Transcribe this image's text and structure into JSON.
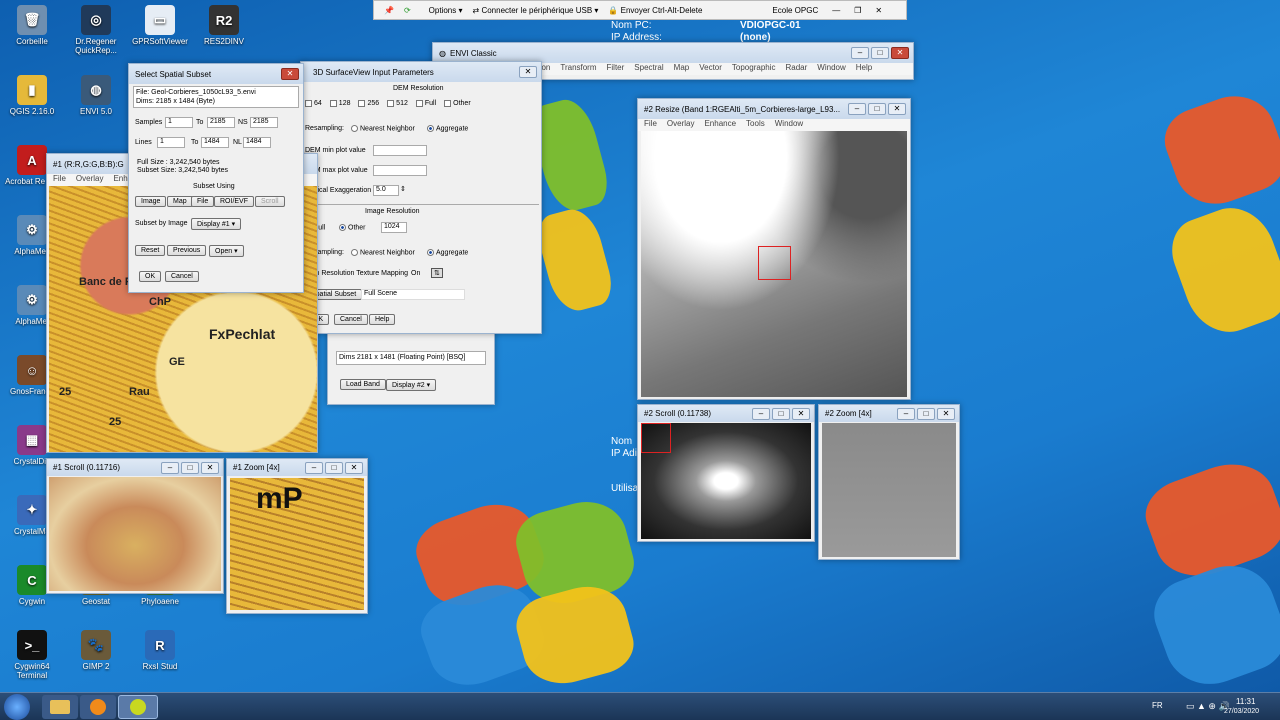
{
  "desktop": {
    "icons": [
      {
        "label": "Corbeille",
        "glyph": "🗑",
        "color": "#6f8fb0"
      },
      {
        "label": "Dr.Regener QuickRep...",
        "glyph": "◎",
        "color": "#203a5a"
      },
      {
        "label": "GPRSoftViewer",
        "glyph": "▭",
        "color": "#e6edf5"
      },
      {
        "label": "RES2DINV",
        "glyph": "R2",
        "color": "#333"
      },
      {
        "label": "QGIS 2.16.0",
        "glyph": "▮",
        "color": "#e5b93a"
      },
      {
        "label": "ENVI 5.0",
        "glyph": "◍",
        "color": "#3a5a7a"
      },
      {
        "label": "Acrobat Re DC",
        "glyph": "A",
        "color": "#c21d1d"
      },
      {
        "label": "AlphaMeli",
        "glyph": "⚙",
        "color": "#5a8ab8"
      },
      {
        "label": "AlphaMel",
        "glyph": "⚙",
        "color": "#5a8ab8"
      },
      {
        "label": "GnosFrance",
        "glyph": "☺",
        "color": "#7a4a2a"
      },
      {
        "label": "CrystalDiff",
        "glyph": "▦",
        "color": "#8a3a8a"
      },
      {
        "label": "CrystalMa",
        "glyph": "✦",
        "color": "#3a6aba"
      },
      {
        "label": "Cygwin",
        "glyph": "C",
        "color": "#1a8a2a"
      },
      {
        "label": "Geostat",
        "glyph": "G",
        "color": "#6a6a2a"
      },
      {
        "label": "Phyloaene",
        "glyph": "P",
        "color": "#3a7a3a"
      },
      {
        "label": "Cygwin64 Terminal",
        "glyph": ">_",
        "color": "#111"
      },
      {
        "label": "GIMP 2",
        "glyph": "🐾",
        "color": "#6a5a3a"
      },
      {
        "label": "RxsI Stud",
        "glyph": "R",
        "color": "#2a6ab8"
      }
    ],
    "pc_info": {
      "nom_pc_label": "Nom PC:",
      "nom_pc_value": "VDIOPGC-01",
      "ip_label": "IP Address:",
      "ip_value": "(none)",
      "nom2": "Nom",
      "ip2": "IP Adi",
      "utilisateur": "Utilisa"
    }
  },
  "remote_bar": {
    "options": "Options",
    "connect": "Connecter le périphérique USB",
    "send": "Envoyer Ctrl-Alt-Delete",
    "host": "Ecole OPGC"
  },
  "envi_classic": {
    "title": "ENVI Classic",
    "menu": [
      "ation",
      "Transform",
      "Filter",
      "Spectral",
      "Map",
      "Vector",
      "Topographic",
      "Radar",
      "Window",
      "Help"
    ]
  },
  "surface": {
    "title": "3D SurfaceView Input Parameters",
    "dem_res": "DEM Resolution",
    "res_options": [
      "64",
      "128",
      "256",
      "512",
      "Full",
      "Other"
    ],
    "resampling": "Resampling:",
    "nearest": "Nearest Neighbor",
    "aggregate": "Aggregate",
    "dem_min": "DEM min plot value",
    "dem_max": "DEM max plot value",
    "vexag": "Vertical Exaggeration",
    "vexag_value": "5.0",
    "img_res": "Image Resolution",
    "full": "Full",
    "other": "Other",
    "other_value": "1024",
    "texture": "High Resolution Texture Mapping",
    "texture_value": "On",
    "spatial_subset": "Spatial Subset",
    "full_scene": "Full Scene",
    "ok": "OK",
    "cancel": "Cancel",
    "help": "Help"
  },
  "subset": {
    "title": "Select Spatial Subset",
    "file": "File: Geol-Corbieres_1050cL93_5.envi",
    "dims": "Dims: 2185 x 1484 (Byte)",
    "samples": "Samples",
    "samples_from": "1",
    "to": "To",
    "samples_to": "2185",
    "ns": "NS",
    "ns_value": "2185",
    "lines": "Lines",
    "lines_from": "1",
    "lines_to": "1484",
    "nl": "NL",
    "nl_value": "1484",
    "full_size": "Full Size : 3,242,540 bytes",
    "subset_size": "Subset Size: 3,242,540 bytes",
    "subset_using": "Subset Using",
    "b_image": "Image",
    "b_map": "Map",
    "b_file": "File",
    "b_roi": "ROI/EVF",
    "b_scroll": "Scroll",
    "by_image": "Subset by Image",
    "display": "Display #1",
    "reset": "Reset",
    "previous": "Previous",
    "open": "Open",
    "ok": "OK",
    "cancel": "Cancel"
  },
  "band_panel": {
    "dims": "Dims 2181 x 1481 (Floating Point) [BSQ]",
    "load_band": "Load Band",
    "display": "Display #2"
  },
  "display1": {
    "title": "#1 (R:R,G:G,B:B):G",
    "menu": [
      "File",
      "Overlay",
      "Enha"
    ],
    "map_labels": [
      "ChP",
      "GE",
      "Rau",
      "25",
      "FxPechlat",
      "Banc de Pech",
      "25"
    ]
  },
  "scroll1": {
    "title": "#1 Scroll (0.11716)"
  },
  "zoom1": {
    "title": "#1 Zoom [4x]",
    "map_text": "mP"
  },
  "resize2": {
    "title": "#2 Resize (Band 1:RGEAlti_5m_Corbieres-large_L93...",
    "menu": [
      "File",
      "Overlay",
      "Enhance",
      "Tools",
      "Window"
    ]
  },
  "scroll2": {
    "title": "#2 Scroll (0.11738)"
  },
  "zoom2": {
    "title": "#2 Zoom [4x]"
  },
  "taskbar": {
    "lang": "FR",
    "time": "11:31",
    "date": "27/03/2020"
  },
  "colors": {
    "accent": "#1a76c8",
    "title": "#dfe9f5",
    "close": "#c94a3a"
  }
}
